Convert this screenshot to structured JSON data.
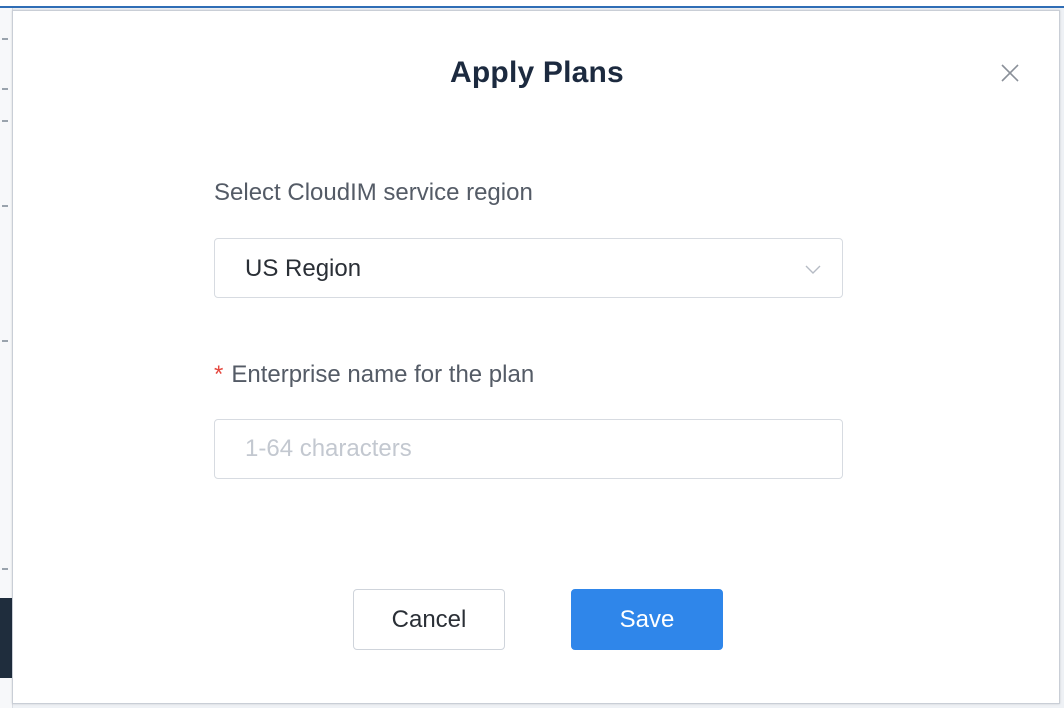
{
  "dialog": {
    "title": "Apply Plans",
    "close_icon": "close-icon"
  },
  "region": {
    "label": "Select CloudIM service region",
    "selected_value": "US Region",
    "dropdown_icon": "chevron-down-icon"
  },
  "enterprise": {
    "required_mark": "*",
    "label": "Enterprise name for the plan",
    "value": "",
    "placeholder": "1-64 characters"
  },
  "actions": {
    "cancel_label": "Cancel",
    "save_label": "Save"
  },
  "colors": {
    "primary": "#2f86ea",
    "title": "#1c2a3f",
    "required": "#e5483f",
    "border": "#d7dbe1"
  }
}
